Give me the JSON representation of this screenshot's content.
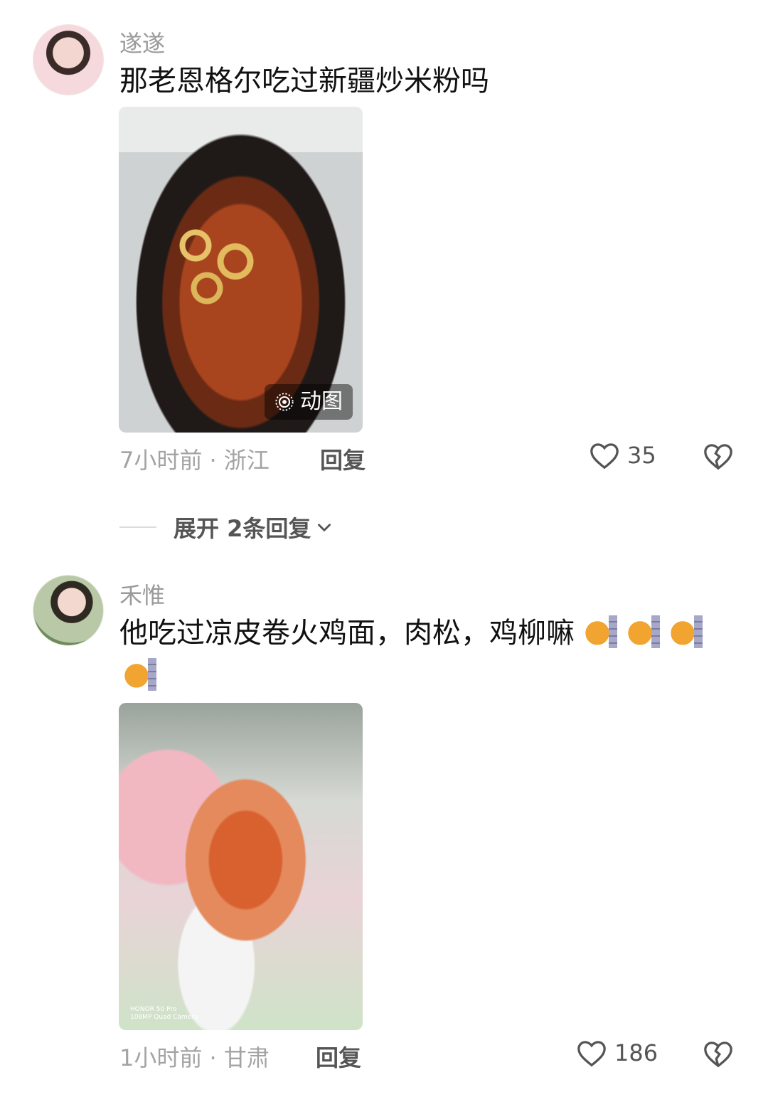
{
  "comments": [
    {
      "username": "遂遂",
      "text": "那老恩格尔吃过新疆炒米粉吗",
      "image_badge": "动图",
      "meta": "7小时前 · 浙江",
      "reply_label": "回复",
      "like_count": "35",
      "expand_label": "展开 2条回复"
    },
    {
      "username": "禾惟",
      "text": "他吃过凉皮卷火鸡面，肉松，鸡柳嘛",
      "emoji_count": 4,
      "camera_watermark_line1": "HONOR 50 Pro",
      "camera_watermark_line2": "108MP Quad Camera",
      "meta": "1小时前 · 甘肃",
      "reply_label": "回复",
      "like_count": "186"
    }
  ],
  "icons": {
    "like": "heart-outline-icon",
    "dislike": "broken-heart-icon",
    "expand": "chevron-down-icon",
    "animated": "live-photo-icon",
    "emoji": "cat-peeking-emoji"
  }
}
